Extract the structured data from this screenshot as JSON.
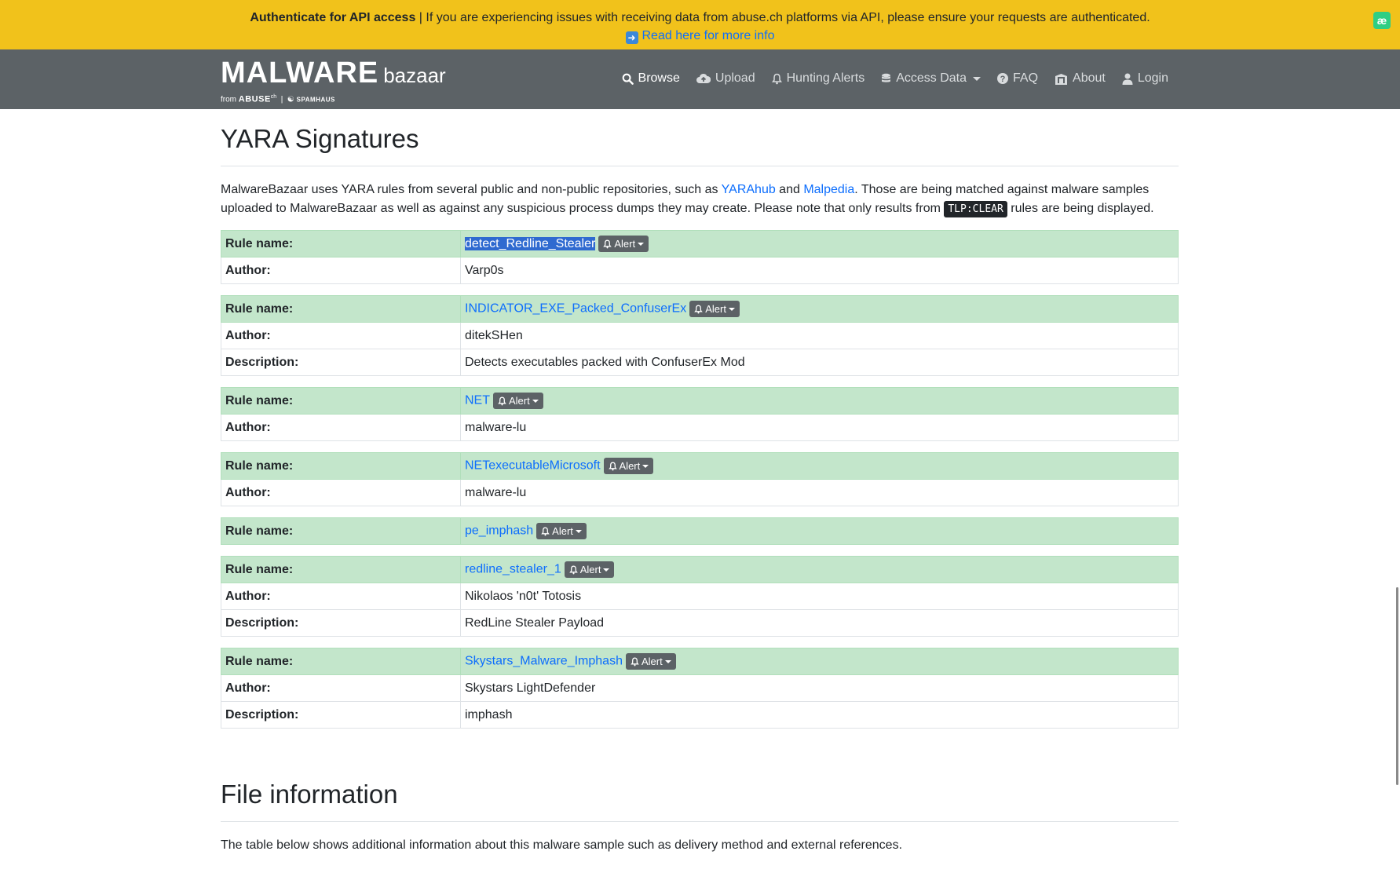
{
  "banner": {
    "title": "Authenticate for API access",
    "message": " | If you are experiencing issues with receiving data from abuse.ch platforms via API, please ensure your requests are authenticated.",
    "link": "Read here for more info",
    "extension_badge": "æ"
  },
  "navbar": {
    "logo_main": "MALWARE",
    "logo_small": "bazaar",
    "logo_from": "from",
    "logo_abuse": "ABUSE",
    "logo_ch": "ch",
    "logo_spamhaus": "SPAMHAUS",
    "items": [
      {
        "label": "Browse",
        "icon": "search-icon"
      },
      {
        "label": "Upload",
        "icon": "cloud-upload-icon"
      },
      {
        "label": "Hunting Alerts",
        "icon": "bell-icon"
      },
      {
        "label": "Access Data",
        "icon": "database-icon"
      },
      {
        "label": "FAQ",
        "icon": "question-circle-icon"
      },
      {
        "label": "About",
        "icon": "building-icon"
      },
      {
        "label": "Login",
        "icon": "user-icon"
      }
    ]
  },
  "yara": {
    "heading": "YARA Signatures",
    "intro_1": "MalwareBazaar uses YARA rules from several public and non-public repositories, such as ",
    "link_yarahub": "YARAhub",
    "intro_and": " and ",
    "link_malpedia": "Malpedia",
    "intro_2": ". Those are being matched against malware samples uploaded to MalwareBazaar as well as against any suspicious process dumps they may create. Please note that only results from ",
    "tlp": "TLP:CLEAR",
    "intro_3": " rules are being displayed.",
    "labels": {
      "rule": "Rule name:",
      "author": "Author:",
      "description": "Description:",
      "alert": "Alert"
    },
    "rules": [
      {
        "name": "detect_Redline_Stealer",
        "author": "Varp0s"
      },
      {
        "name": "INDICATOR_EXE_Packed_ConfuserEx",
        "author": "ditekSHen",
        "description": "Detects executables packed with ConfuserEx Mod"
      },
      {
        "name": "NET",
        "author": "malware-lu"
      },
      {
        "name": "NETexecutableMicrosoft",
        "author": "malware-lu"
      },
      {
        "name": "pe_imphash"
      },
      {
        "name": "redline_stealer_1",
        "author": "Nikolaos 'n0t' Totosis",
        "description": "RedLine Stealer Payload"
      },
      {
        "name": "Skystars_Malware_Imphash",
        "author": "Skystars LightDefender",
        "description": "imphash"
      }
    ]
  },
  "file_info": {
    "heading": "File information",
    "intro": "The table below shows additional information about this malware sample such as delivery method and external references."
  },
  "colors": {
    "banner": "#f1c21b",
    "navbar": "#5c6266",
    "rule_header": "#c3e6cb",
    "link": "#0d6efd"
  }
}
